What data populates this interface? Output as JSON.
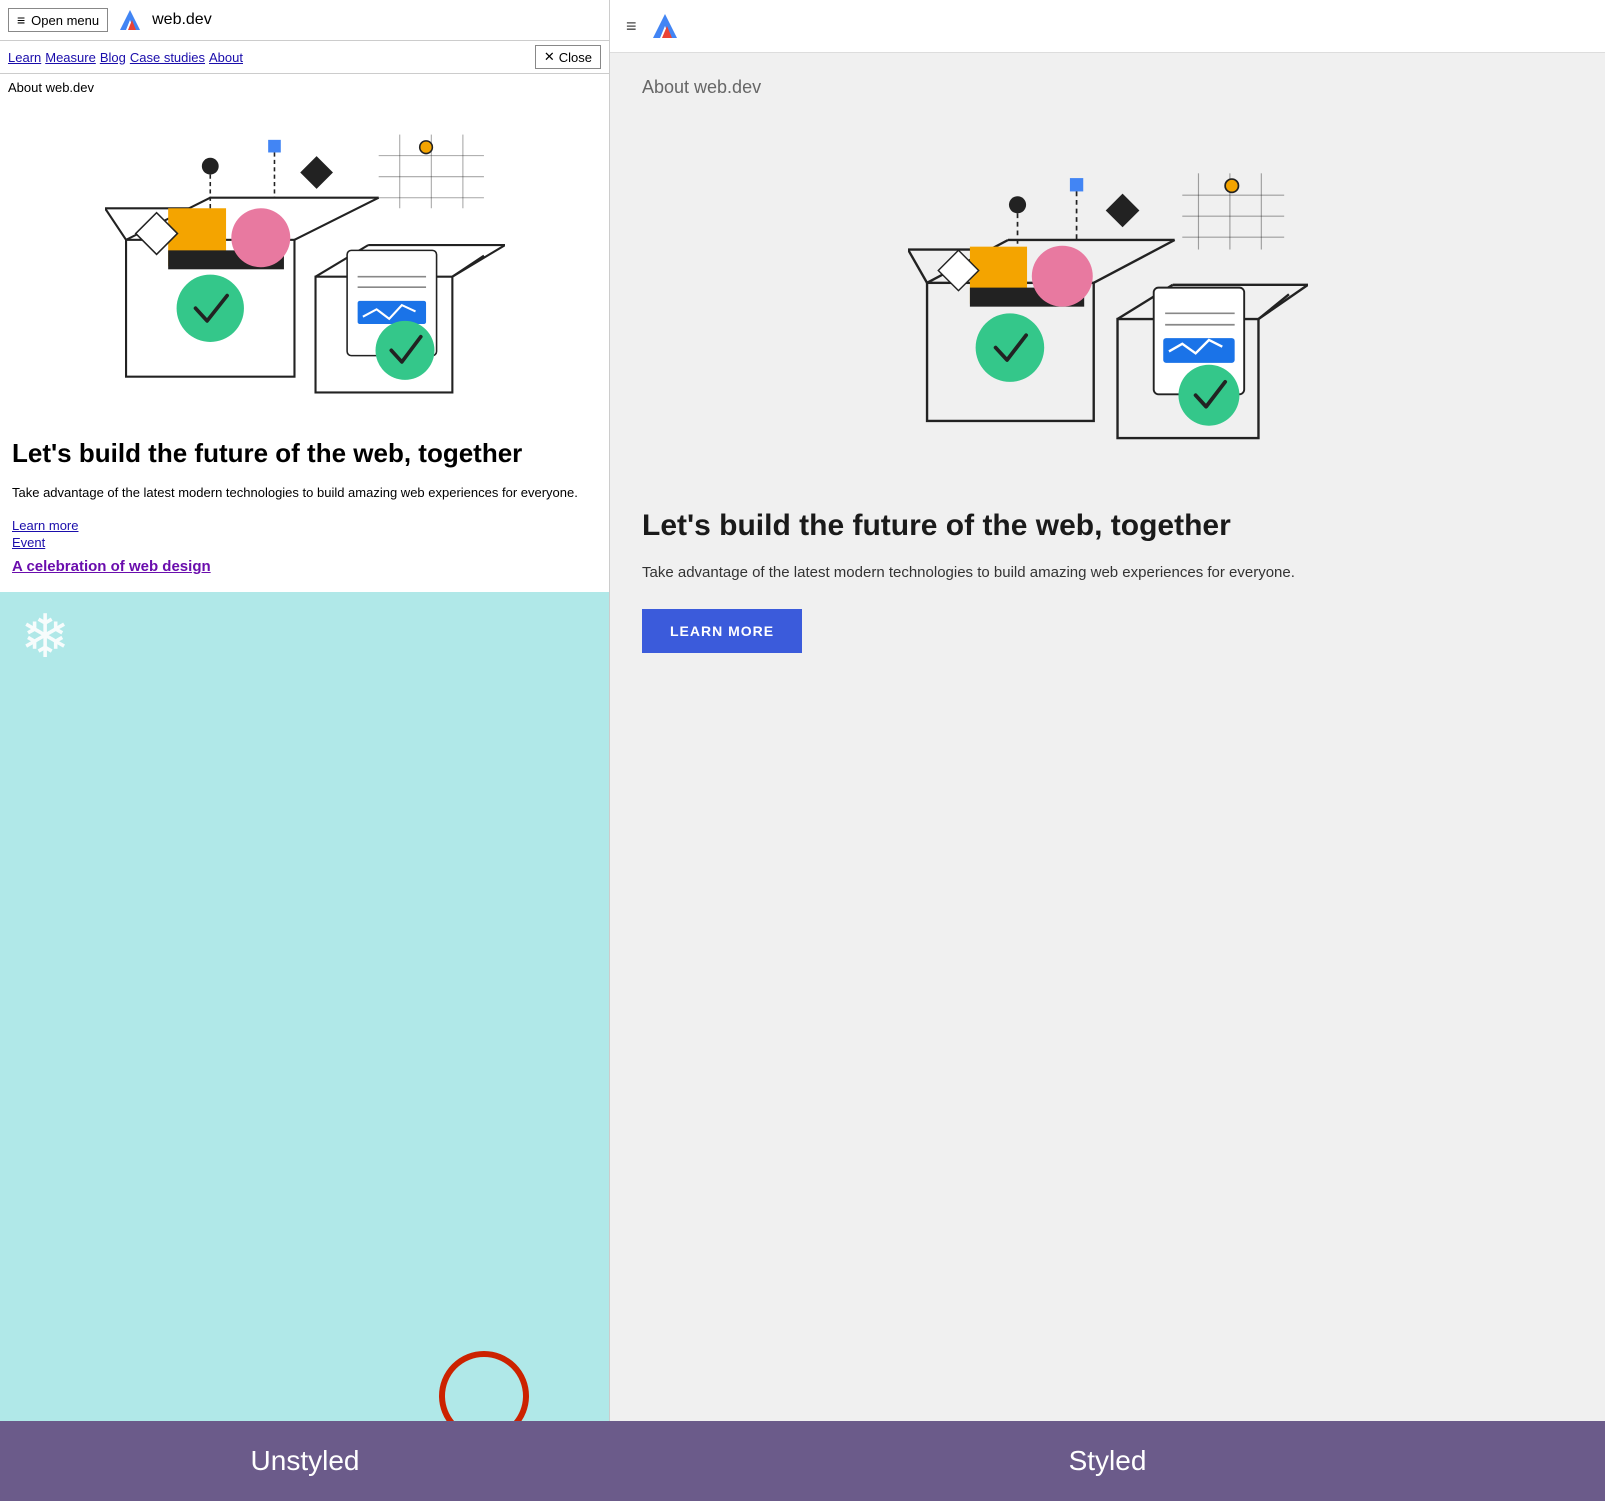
{
  "left": {
    "menu_button": "Open menu",
    "site_title": "web.dev",
    "nav": {
      "items": [
        "Learn",
        "Measure",
        "Blog",
        "Case studies",
        "About"
      ]
    },
    "close_button": "Close",
    "page_label": "About web.dev",
    "hero_heading": "Let's build the future of the web, together",
    "hero_desc": "Take advantage of the latest modern technologies to build amazing web experiences for everyone.",
    "learn_more_link": "Learn more",
    "event_link": "Event",
    "celebration_link": "A celebration of web design"
  },
  "right": {
    "page_label": "About web.dev",
    "hero_heading": "Let's build the future of the web, together",
    "hero_desc": "Take advantage of the latest modern technologies to build amazing web experiences for everyone.",
    "learn_more_btn": "LEARN MORE"
  },
  "bottom": {
    "label_unstyled": "Unstyled",
    "label_styled": "Styled"
  },
  "icons": {
    "hamburger": "≡",
    "close": "✕",
    "snowflake": "❄"
  }
}
